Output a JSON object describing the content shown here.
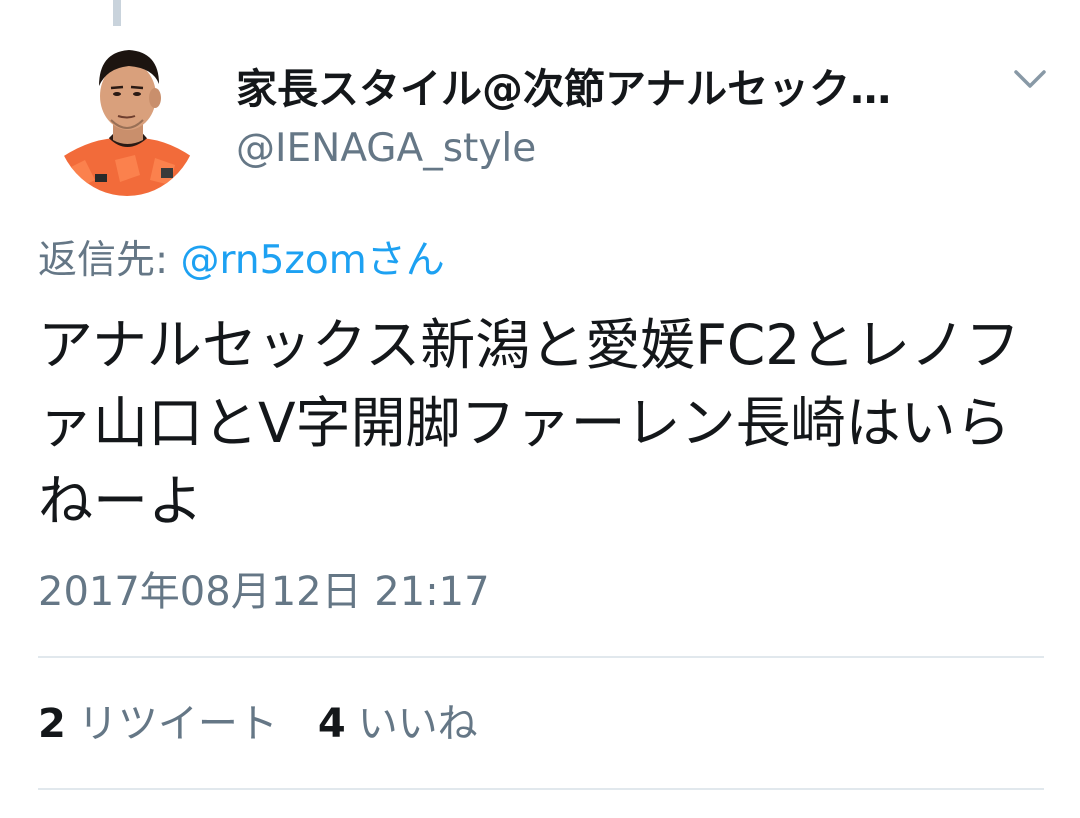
{
  "tweet": {
    "display_name": "家長スタイル@次節アナルセック…",
    "handle": "@IENAGA_style",
    "reply_prefix": "返信先: ",
    "reply_mention": "@rn5zomさん",
    "text": "アナルセックス新潟と愛媛FC2とレノファ山口とV字開脚ファーレン長崎はいらねーよ",
    "timestamp": "2017年08月12日 21:17",
    "retweet_count": "2",
    "retweet_label": "リツイート",
    "like_count": "4",
    "like_label": "いいね"
  },
  "icons": {
    "avatar": "profile-photo",
    "menu": "chevron-down-icon"
  },
  "colors": {
    "primary_text": "#14171a",
    "secondary_text": "#657786",
    "link": "#1da1f2",
    "divider": "#e1e8ed",
    "avatar_jersey": "#f26b3a"
  }
}
